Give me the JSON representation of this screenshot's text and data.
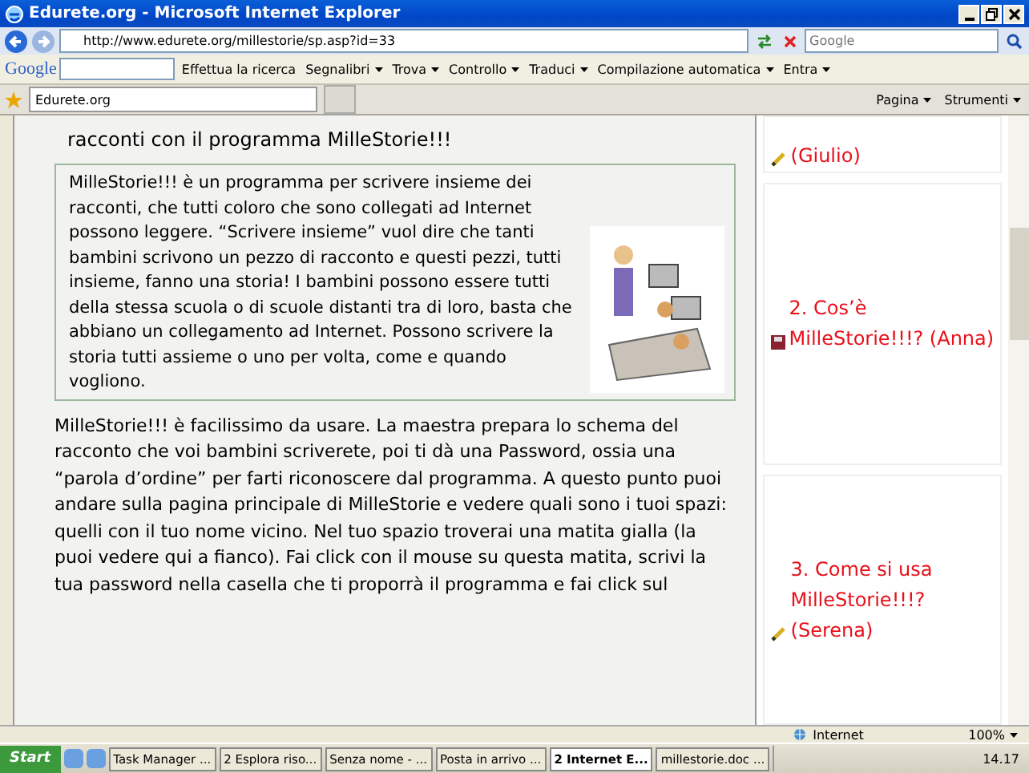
{
  "window": {
    "title": "Edurete.org - Microsoft Internet Explorer"
  },
  "address_bar": {
    "url": "http://www.edurete.org/millestorie/sp.asp?id=33",
    "search_placeholder": "Google"
  },
  "google_toolbar": {
    "logo": "Google",
    "search_button": "Effettua la ricerca",
    "items": [
      "Segnalibri",
      "Trova",
      "Controllo",
      "Traduci",
      "Compilazione automatica",
      "Entra"
    ]
  },
  "tabs": [
    {
      "label": "Edurete.org",
      "selected": true
    }
  ],
  "command_bar": {
    "items": [
      "Pagina",
      "Strumenti"
    ]
  },
  "article": {
    "intro": "racconti con il programma MilleStorie!!!",
    "box_text": "MilleStorie!!! è un programma per scrivere insieme dei racconti, che tutti coloro che sono collegati ad Internet possono leggere. “Scrivere insieme” vuol dire che tanti bambini scrivono un pezzo di racconto e questi pezzi, tutti insieme, fanno una storia! I bambini possono essere tutti della stessa scuola o di scuole distanti tra di loro, basta che abbiano un collegamento ad Internet. Possono scrivere la storia tutti assieme o uno per volta, come e quando vogliono.",
    "body_text": "MilleStorie!!! è facilissimo da usare. La maestra prepara lo schema del racconto che voi bambini scriverete, poi ti dà una Password, ossia una “parola d’ordine” per farti riconoscere dal programma. A questo punto puoi andare sulla pagina principale di MilleStorie e vedere quali sono i tuoi spazi: quelli con il tuo nome vicino. Nel tuo spazio troverai una matita gialla (la puoi vedere qui a fianco). Fai click con il mouse su questa matita, scrivi la tua password nella casella che ti proporrà il programma e fai click sul"
  },
  "sidebar": {
    "items": [
      {
        "label": "(Giulio)",
        "kind": "pencil"
      },
      {
        "label": "2. Cos’è MilleStorie!!!? (Anna)",
        "kind": "disk"
      },
      {
        "label": "3. Come si usa MilleStorie!!!? (Serena)",
        "kind": "pencil"
      }
    ]
  },
  "status_bar": {
    "zone": "Internet",
    "zoom": "100%"
  },
  "taskbar": {
    "start": "Start",
    "buttons": [
      {
        "label": "Task Manager ...",
        "selected": false
      },
      {
        "label": "2 Esplora riso...",
        "selected": false
      },
      {
        "label": "Senza nome - ...",
        "selected": false
      },
      {
        "label": "Posta in arrivo ...",
        "selected": false
      },
      {
        "label": "2 Internet E...",
        "selected": true
      },
      {
        "label": "millestorie.doc ...",
        "selected": false
      }
    ],
    "clock": "14.17"
  }
}
